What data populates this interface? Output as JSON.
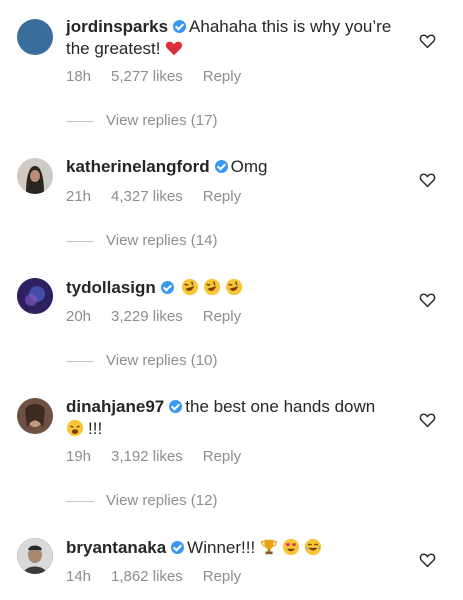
{
  "comments": [
    {
      "username": "jordinsparks",
      "text": "Ahahaha this is why you’re the greatest!",
      "emojis": [
        "red-heart"
      ],
      "time": "18h",
      "likes": "5,277 likes",
      "reply_label": "Reply",
      "view_replies": "View replies (17)",
      "avatar_color": "#3a6d9a"
    },
    {
      "username": "katherinelangford",
      "text": "Omg",
      "emojis": [],
      "time": "21h",
      "likes": "4,327 likes",
      "reply_label": "Reply",
      "view_replies": "View replies (14)",
      "avatar_color": "#3b3430"
    },
    {
      "username": "tydollasign",
      "text": "",
      "emojis": [
        "rofl",
        "rofl",
        "rofl"
      ],
      "time": "20h",
      "likes": "3,229 likes",
      "reply_label": "Reply",
      "view_replies": "View replies (10)",
      "avatar_color": "#3b2a6e"
    },
    {
      "username": "dinahjane97",
      "text": "the best one hands down",
      "text2": "!!!",
      "emojis": [
        "weary-face"
      ],
      "time": "19h",
      "likes": "3,192 likes",
      "reply_label": "Reply",
      "view_replies": "View replies (12)",
      "avatar_color": "#8a6a55"
    },
    {
      "username": "bryantanaka",
      "text": "Winner!!!",
      "emojis": [
        "trophy",
        "heart-eyes",
        "joy"
      ],
      "time": "14h",
      "likes": "1,862 likes",
      "reply_label": "Reply",
      "avatar_color": "#5a5a5a"
    }
  ],
  "colors": {
    "text": "#262626",
    "meta": "#8e8e8e",
    "verified": "#3897f0"
  }
}
